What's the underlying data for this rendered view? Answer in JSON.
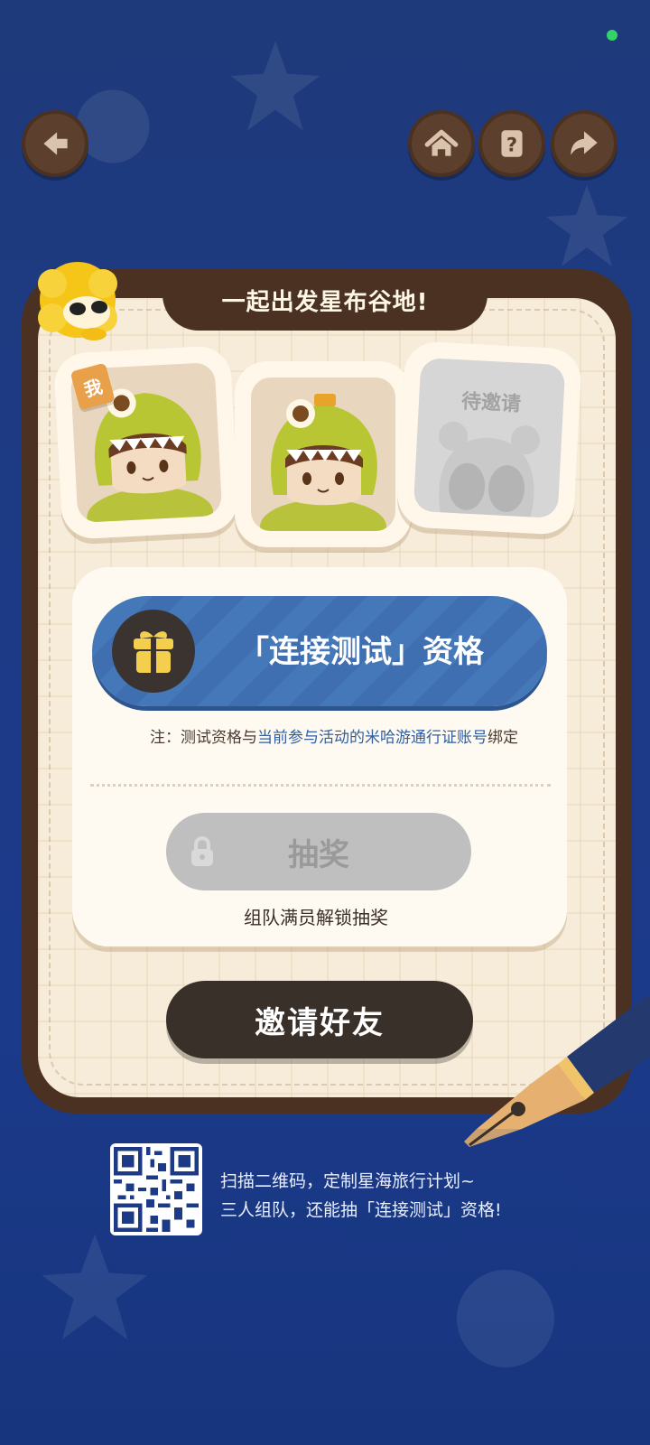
{
  "colors": {
    "background": "#1d3a86",
    "card_frame": "#4a3122",
    "card_paper": "#f6ecd9",
    "prize_blue": "#3f6fb0",
    "invite_dark": "#3a302a",
    "link_blue": "#2f5fa0",
    "disabled_gray": "#bfbfbf"
  },
  "header": {
    "back_icon": "back-arrow-icon",
    "home_icon": "home-icon",
    "help_icon": "help-icon",
    "share_icon": "share-icon"
  },
  "card": {
    "title": "一起出发星布谷地!",
    "mascot_icon": "lion-mascot-icon",
    "slots": [
      {
        "tag": "我",
        "state": "filled"
      },
      {
        "state": "filled"
      },
      {
        "label": "待邀请",
        "state": "pending"
      }
    ]
  },
  "prize": {
    "icon": "gift-icon",
    "label": "「连接测试」资格",
    "note_prefix": "注：测试资格与",
    "note_highlight": "当前参与活动的米哈游通行证账号",
    "note_suffix": "绑定"
  },
  "draw": {
    "label": "抽奖",
    "lock_icon": "lock-icon",
    "hint": "组队满员解锁抽奖",
    "enabled": false
  },
  "invite": {
    "label": "邀请好友"
  },
  "footer": {
    "qr_icon": "qr-code-icon",
    "line1": "扫描二维码，定制星海旅行计划~",
    "line2": "三人组队，还能抽「连接测试」资格!"
  }
}
